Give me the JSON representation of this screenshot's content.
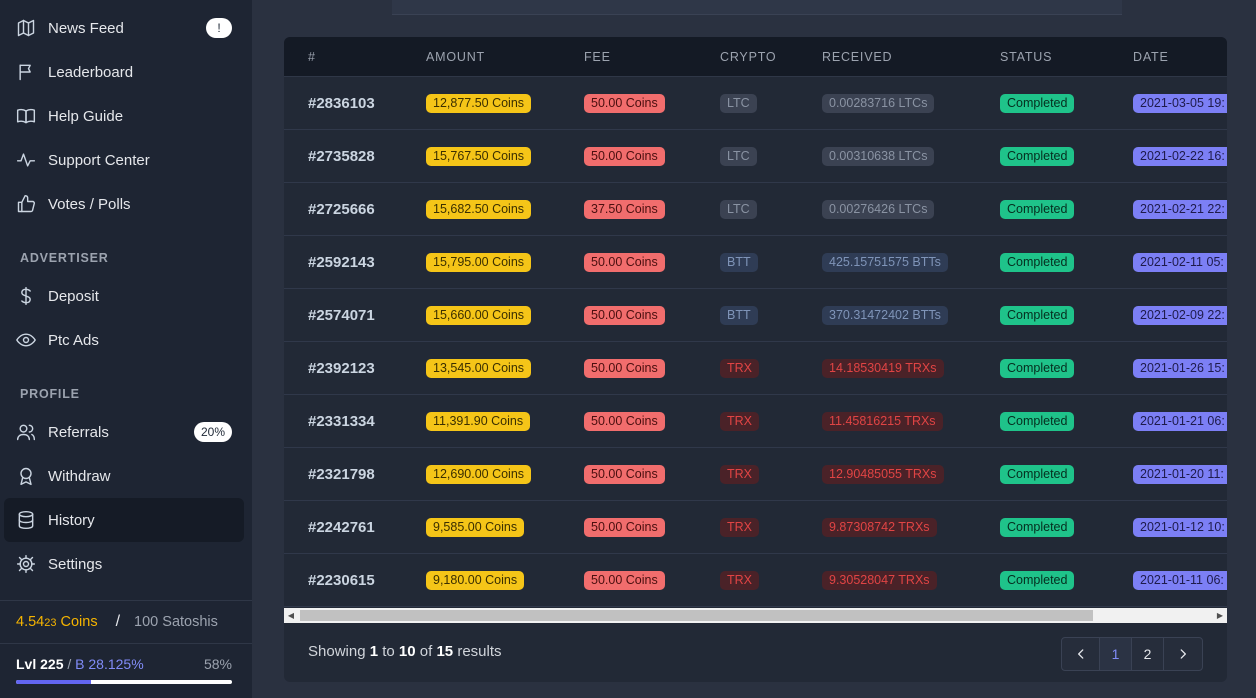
{
  "sidebar": {
    "nav_top": [
      {
        "label": "News Feed",
        "icon": "map-icon",
        "badge": "!"
      },
      {
        "label": "Leaderboard",
        "icon": "flag-icon"
      },
      {
        "label": "Help Guide",
        "icon": "book-icon"
      },
      {
        "label": "Support Center",
        "icon": "activity-icon"
      },
      {
        "label": "Votes / Polls",
        "icon": "thumbs-up-icon"
      }
    ],
    "advertiser_title": "ADVERTISER",
    "advertiser": [
      {
        "label": "Deposit",
        "icon": "dollar-icon"
      },
      {
        "label": "Ptc Ads",
        "icon": "eye-icon"
      }
    ],
    "profile_title": "PROFILE",
    "profile": [
      {
        "label": "Referrals",
        "icon": "users-icon",
        "badge": "20%"
      },
      {
        "label": "Withdraw",
        "icon": "award-icon"
      },
      {
        "label": "History",
        "icon": "database-icon",
        "active": true
      },
      {
        "label": "Settings",
        "icon": "gear-icon"
      }
    ],
    "balance": {
      "coins_main": "4.54",
      "coins_small": "23",
      "coins_unit": " Coins",
      "slash": "/",
      "satoshi": "100 Satoshis"
    },
    "level": {
      "lvl": "Lvl 225",
      "sep": " / ",
      "bonus": "B 28.125%",
      "percent": "58%",
      "progress": 0.58
    }
  },
  "table": {
    "headers": [
      "#",
      "AMOUNT",
      "FEE",
      "CRYPTO",
      "RECEIVED",
      "STATUS",
      "DATE"
    ],
    "rows": [
      {
        "id": "#2836103",
        "amount": "12,877.50 Coins",
        "fee": "50.00 Coins",
        "crypto": "LTC",
        "received": "0.00283716 LTCs",
        "status": "Completed",
        "date": "2021-03-05 19:"
      },
      {
        "id": "#2735828",
        "amount": "15,767.50 Coins",
        "fee": "50.00 Coins",
        "crypto": "LTC",
        "received": "0.00310638 LTCs",
        "status": "Completed",
        "date": "2021-02-22 16:"
      },
      {
        "id": "#2725666",
        "amount": "15,682.50 Coins",
        "fee": "37.50 Coins",
        "crypto": "LTC",
        "received": "0.00276426 LTCs",
        "status": "Completed",
        "date": "2021-02-21 22:"
      },
      {
        "id": "#2592143",
        "amount": "15,795.00 Coins",
        "fee": "50.00 Coins",
        "crypto": "BTT",
        "received": "425.15751575 BTTs",
        "status": "Completed",
        "date": "2021-02-11 05:"
      },
      {
        "id": "#2574071",
        "amount": "15,660.00 Coins",
        "fee": "50.00 Coins",
        "crypto": "BTT",
        "received": "370.31472402 BTTs",
        "status": "Completed",
        "date": "2021-02-09 22:"
      },
      {
        "id": "#2392123",
        "amount": "13,545.00 Coins",
        "fee": "50.00 Coins",
        "crypto": "TRX",
        "received": "14.18530419 TRXs",
        "status": "Completed",
        "date": "2021-01-26 15:"
      },
      {
        "id": "#2331334",
        "amount": "11,391.90 Coins",
        "fee": "50.00 Coins",
        "crypto": "TRX",
        "received": "11.45816215 TRXs",
        "status": "Completed",
        "date": "2021-01-21 06:"
      },
      {
        "id": "#2321798",
        "amount": "12,690.00 Coins",
        "fee": "50.00 Coins",
        "crypto": "TRX",
        "received": "12.90485055 TRXs",
        "status": "Completed",
        "date": "2021-01-20 11:"
      },
      {
        "id": "#2242761",
        "amount": "9,585.00 Coins",
        "fee": "50.00 Coins",
        "crypto": "TRX",
        "received": "9.87308742 TRXs",
        "status": "Completed",
        "date": "2021-01-12 10:"
      },
      {
        "id": "#2230615",
        "amount": "9,180.00 Coins",
        "fee": "50.00 Coins",
        "crypto": "TRX",
        "received": "9.30528047 TRXs",
        "status": "Completed",
        "date": "2021-01-11 06:"
      }
    ],
    "crypto_colors": {
      "LTC": {
        "bg": "#3b4252",
        "fg": "#8a93a3"
      },
      "BTT": {
        "bg": "#2f3c55",
        "fg": "#7f94b8"
      },
      "TRX": {
        "bg": "#4a2228",
        "fg": "#e04444"
      }
    }
  },
  "pagination": {
    "showing": "Showing ",
    "from": "1",
    "to_word": " to ",
    "to": "10",
    "of_word": " of ",
    "total": "15",
    "results": " results",
    "prev": "‹",
    "pages": [
      "1",
      "2"
    ],
    "current": "1",
    "next": "›"
  }
}
